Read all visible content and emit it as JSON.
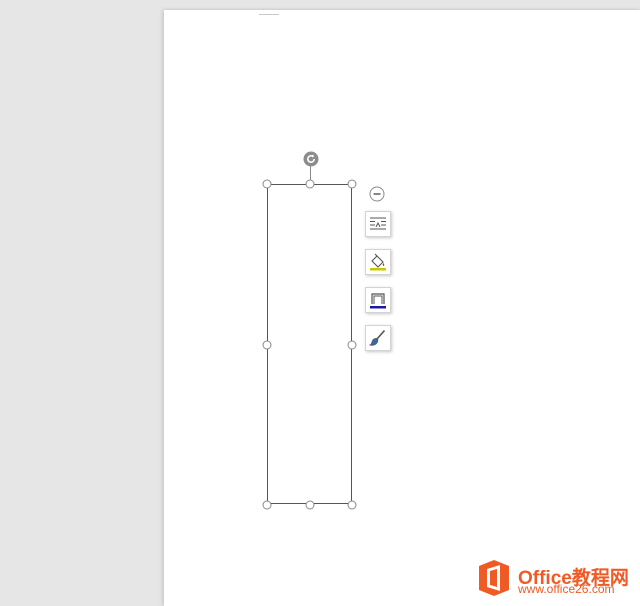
{
  "shape_toolbar": {
    "collapse": {
      "icon": "minus-circle-icon"
    },
    "buttons": [
      {
        "id": "layout-options",
        "icon": "text-wrap-icon"
      },
      {
        "id": "shape-fill",
        "icon": "paint-bucket-icon",
        "accent": "#c8c800"
      },
      {
        "id": "shape-outline",
        "icon": "shape-outline-icon",
        "accent": "#1a1aa6"
      },
      {
        "id": "shape-effects",
        "icon": "brush-icon",
        "accent": "#2e6db5"
      }
    ]
  },
  "watermark": {
    "brand": "Office教程网",
    "url": "www.office26.com",
    "color": "#f05a24"
  }
}
